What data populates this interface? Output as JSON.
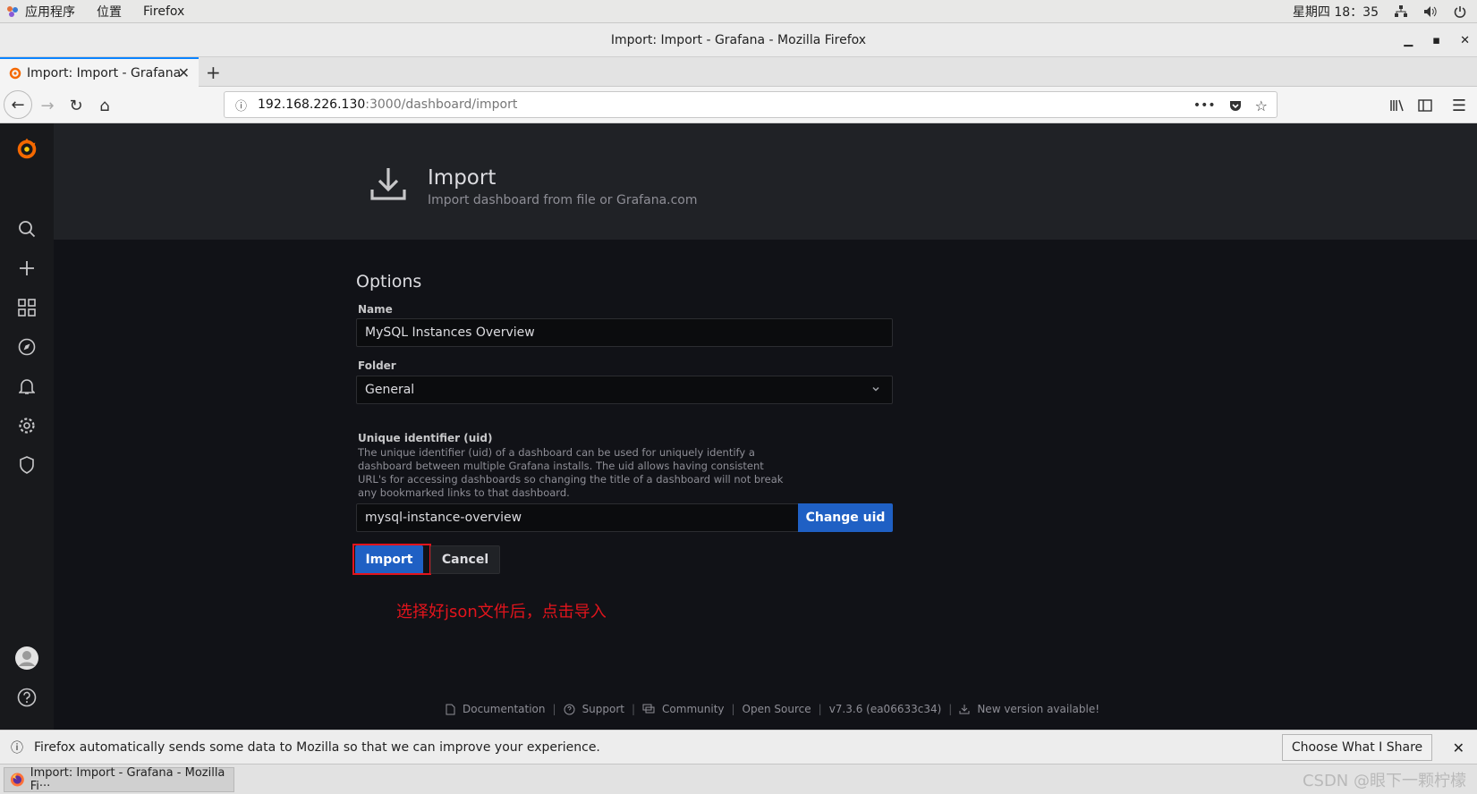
{
  "system_bar": {
    "apps_label": "应用程序",
    "places_label": "位置",
    "firefox_label": "Firefox",
    "clock": "星期四 18：35"
  },
  "window": {
    "title": "Import: Import - Grafana - Mozilla Firefox"
  },
  "tab": {
    "label": "Import: Import - Grafana"
  },
  "urlbar": {
    "host": "192.168.226.130",
    "path": ":3000/dashboard/import",
    "more": "•••"
  },
  "page_header": {
    "title": "Import",
    "subtitle": "Import dashboard from file or Grafana.com"
  },
  "form": {
    "section_title": "Options",
    "name_label": "Name",
    "name_value": "MySQL Instances Overview",
    "folder_label": "Folder",
    "folder_value": "General",
    "uid_label": "Unique identifier (uid)",
    "uid_description": "The unique identifier (uid) of a dashboard can be used for uniquely identify a dashboard between multiple Grafana installs. The uid allows having consistent URL's for accessing dashboards so changing the title of a dashboard will not break any bookmarked links to that dashboard.",
    "uid_value": "mysql-instance-overview",
    "change_uid_label": "Change uid",
    "import_label": "Import",
    "cancel_label": "Cancel"
  },
  "annotation": {
    "text": "选择好json文件后，点击导入",
    "color": "#e2141c"
  },
  "footer": {
    "documentation": "Documentation",
    "support": "Support",
    "community": "Community",
    "open_source": "Open Source",
    "version": "v7.3.6 (ea06633c34)",
    "new_version": "New version available!"
  },
  "notification": {
    "text": "Firefox automatically sends some data to Mozilla so that we can improve your experience.",
    "share_button": "Choose What I Share"
  },
  "taskbar": {
    "item": "Import: Import - Grafana - Mozilla Fi···",
    "watermark": "CSDN @眼下一颗柠檬"
  },
  "colors": {
    "accent": "#1f60c4",
    "grafana_orange": "#f46800",
    "firefox_blue": "#0a84ff"
  }
}
